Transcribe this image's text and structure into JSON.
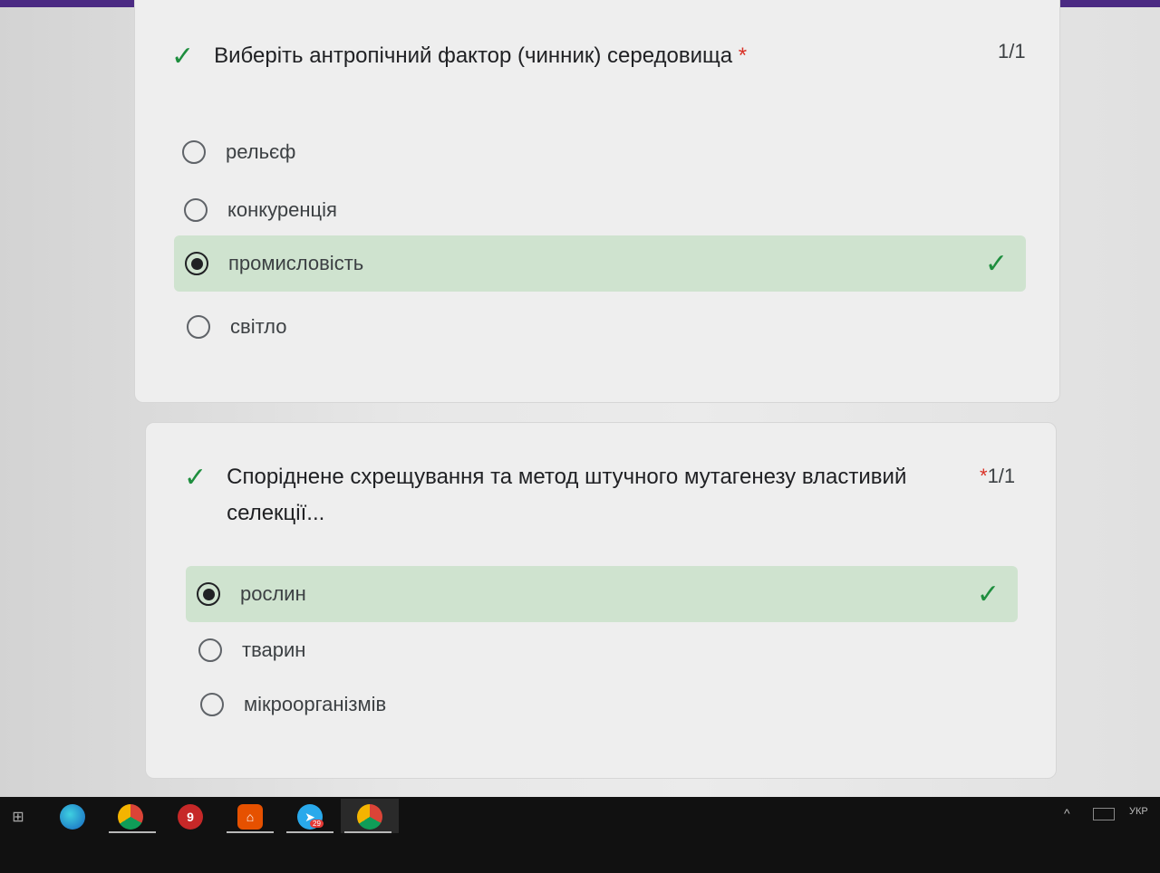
{
  "questions": [
    {
      "title": "Виберіть антропічний фактор (чинник) середовища",
      "required_mark": "*",
      "score": "1/1",
      "options": [
        {
          "label": "рельєф",
          "selected": false,
          "correct": false
        },
        {
          "label": "конкуренція",
          "selected": false,
          "correct": false
        },
        {
          "label": "промисловість",
          "selected": true,
          "correct": true
        },
        {
          "label": "світло",
          "selected": false,
          "correct": false
        }
      ]
    },
    {
      "title_line1": "Споріднене схрещування та метод штучного мутагенезу властивий",
      "title_line2": "селекції...",
      "required_mark": "*",
      "score": "1/1",
      "options": [
        {
          "label": "рослин",
          "selected": true,
          "correct": true
        },
        {
          "label": "тварин",
          "selected": false,
          "correct": false
        },
        {
          "label": "мікроорганізмів",
          "selected": false,
          "correct": false
        }
      ]
    }
  ],
  "taskbar": {
    "icons": [
      "task-view-icon",
      "edge-icon",
      "chrome-icon",
      "app-icon",
      "office-icon",
      "telegram-icon",
      "chrome-profile-icon"
    ],
    "telegram_badge": "29",
    "language": "УКР"
  },
  "colors": {
    "accent": "#4b2a83",
    "correct_bg": "#cfe3cf",
    "check": "#1e8e3e",
    "required": "#d93025"
  }
}
